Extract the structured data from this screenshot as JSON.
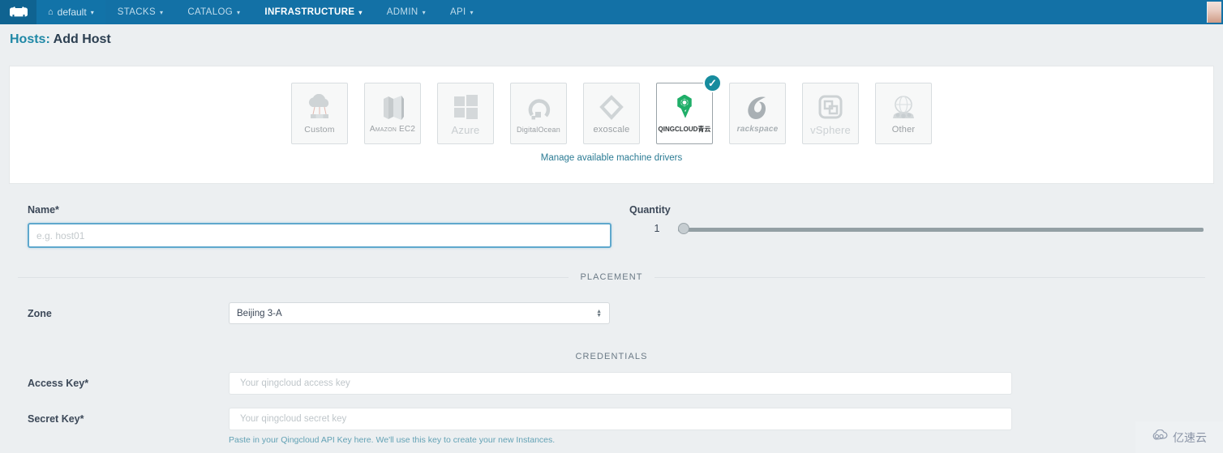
{
  "navbar": {
    "logo_icon": "rancher-cow-logo-icon",
    "environment": {
      "icon": "home-icon",
      "label": "default",
      "caret": "▾"
    },
    "items": [
      {
        "label": "STACKS",
        "caret": "▾",
        "active": false
      },
      {
        "label": "CATALOG",
        "caret": "▾",
        "active": false
      },
      {
        "label": "INFRASTRUCTURE",
        "caret": "▾",
        "active": true
      },
      {
        "label": "ADMIN",
        "caret": "▾",
        "active": false
      },
      {
        "label": "API",
        "caret": "▾",
        "active": false
      }
    ],
    "avatar_icon": "user-avatar-icon"
  },
  "page": {
    "title_prefix": "Hosts:",
    "title_main": "Add Host"
  },
  "drivers": {
    "items": [
      {
        "name": "Custom",
        "icon": "custom-cloud-icon",
        "selected": false
      },
      {
        "name": "Amazon EC2",
        "icon": "amazon-ec2-icon",
        "selected": false
      },
      {
        "name": "Azure",
        "icon": "azure-windows-icon",
        "selected": false
      },
      {
        "name": "DigitalOcean",
        "icon": "digitalocean-icon",
        "selected": false
      },
      {
        "name": "exoscale",
        "icon": "exoscale-icon",
        "selected": false
      },
      {
        "name": "QINGCLOUD青云",
        "icon": "qingcloud-icon",
        "selected": true
      },
      {
        "name": "rackspace",
        "icon": "rackspace-icon",
        "selected": false
      },
      {
        "name": "vSphere",
        "icon": "vsphere-icon",
        "selected": false
      },
      {
        "name": "Other",
        "icon": "other-globe-icon",
        "selected": false
      }
    ],
    "selected_badge_icon": "check-circle-icon",
    "manage_link": "Manage available machine drivers"
  },
  "form": {
    "name": {
      "label": "Name*",
      "value": "",
      "placeholder": "e.g. host01"
    },
    "quantity": {
      "label": "Quantity",
      "value": "1",
      "slider_min": 1,
      "slider_max": 100,
      "slider_position_percent": 0
    },
    "placement": {
      "section_label": "PLACEMENT",
      "zone_label": "Zone",
      "zone_value": "Beijing 3-A",
      "zone_caret_icon": "select-spinner-icon"
    },
    "credentials": {
      "section_label": "CREDENTIALS",
      "access_key": {
        "label": "Access Key*",
        "value": "",
        "placeholder": "Your qingcloud access key"
      },
      "secret_key": {
        "label": "Secret Key*",
        "value": "",
        "placeholder": "Your qingcloud secret key"
      },
      "help_text": "Paste in your Qingcloud API Key here. We'll use this key to create your new Instances."
    }
  },
  "watermark": {
    "icon": "cloud-logo-icon",
    "text": "亿速云"
  },
  "colors": {
    "navbar_bg": "#1371a6",
    "page_bg": "#eceff1",
    "accent_teal": "#1f88a6",
    "selected_badge": "#178c9e",
    "focus_border": "#5fa8cd",
    "link": "#2b7b94",
    "qingcloud_green": "#1fae68"
  }
}
